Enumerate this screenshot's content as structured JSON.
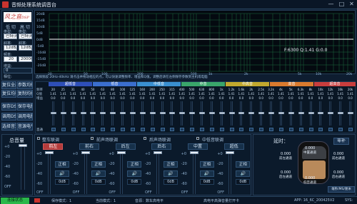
{
  "app": {
    "title": "音频处理系统调音台"
  },
  "window": {
    "min": "—",
    "max": "□",
    "close": "✕"
  },
  "logo": {
    "text": "风之音",
    "sub": "DSP"
  },
  "crossover": {
    "low_cut": "低 切",
    "high_cut": "高 切",
    "type_label": "类型:",
    "type_value": "巴特沃斯",
    "slope_label": "斜率:",
    "slope_value": "12dB/Oct",
    "freq_label": "频率:",
    "low_freq": "20",
    "high_freq": "20000",
    "gain_label": "增益:",
    "gain_value": "0",
    "phase_label": "相位:",
    "phase_value": "0"
  },
  "left_buttons": [
    "复位全部",
    "参数均衡",
    "复位均衡",
    "复制均衡",
    "保存DSP",
    "保存电脑",
    "调用DSP",
    "调用电脑",
    "选择音源",
    "音源电平"
  ],
  "graph": {
    "y_labels": [
      "20dB",
      "15dB",
      "10dB",
      "5dB",
      "0dB",
      "-5dB",
      "-10dB",
      "-15dB",
      "-20dB"
    ],
    "x_labels": [
      "20",
      "50",
      "100",
      "200",
      "500",
      "1k",
      "2k",
      "5k",
      "10k",
      "20k"
    ],
    "readout": "F:6300 Q:1.41 G:0.0",
    "note": "选择频段   20Hz-40kHz   请点击并拖动相应的点，可以快速调整频率、增益和Q值。调整后请在左侧保存参数到主机或电脑"
  },
  "eq_groups": [
    {
      "label": "超低音",
      "color": "#2e4fb8"
    },
    {
      "label": "低音",
      "color": "#3b6fce"
    },
    {
      "label": "中低音",
      "color": "#3a8fd0"
    },
    {
      "label": "中音",
      "color": "#3aa66b"
    },
    {
      "label": "中高音",
      "color": "#c2a82e"
    },
    {
      "label": "高音",
      "color": "#d97a2e"
    },
    {
      "label": "超高音",
      "color": "#c93d3d"
    }
  ],
  "eq_rows": {
    "freq_label": "频率",
    "q_label": "Q值",
    "gain_label": "增益",
    "reset_label": "直通",
    "freq_values": [
      "20",
      "25",
      "31",
      "40",
      "50",
      "63",
      "80",
      "100",
      "125",
      "160",
      "200",
      "250",
      "315",
      "400",
      "500",
      "630",
      "800",
      "1k",
      "1.2k",
      "1.6k",
      "2k",
      "2.5k",
      "3.2k",
      "4k",
      "5k",
      "6.3k",
      "8k",
      "10k",
      "12k",
      "16k",
      "20k"
    ],
    "q_value": "1.41",
    "gain_value": "0.0"
  },
  "master": {
    "title": "总音量",
    "scale": [
      "+0",
      "-20",
      "-40",
      "-60",
      "OFF"
    ],
    "db": "0dB"
  },
  "linking": {
    "items": [
      "整车联调",
      "前声场联调",
      "后声场联调",
      "中低音联调"
    ],
    "channels": [
      "前左",
      "前右",
      "后左",
      "后右",
      "中置",
      "超低"
    ],
    "phase_label": "正相",
    "scale": [
      "+0",
      "-20",
      "-40",
      "-60",
      "OFF"
    ],
    "db_value": "0dB"
  },
  "delay": {
    "title": "延时：",
    "reset": "零补",
    "ms_label": "0.000",
    "front_left": "前左通道",
    "front_right": "前右通道",
    "rear_left": "后左通道",
    "rear_right": "后右通道",
    "center": "中置通道",
    "sub": "低音通道",
    "unit": "毫秒/MS/厘米"
  },
  "status": {
    "connection": "连接状态",
    "save_mode": "保存模式：1",
    "current_mode": "当前模式：1",
    "source": "音源：数车高电平",
    "center": "高电平高弹音量打开卡",
    "app": "APP: 16_6C_200425V2",
    "sys": "SYS:"
  },
  "colors": {
    "accent": "#d03c3c",
    "graph_grid": "#1f6a3f",
    "graph_bg": "#040a10",
    "curve": "#ffffff"
  }
}
